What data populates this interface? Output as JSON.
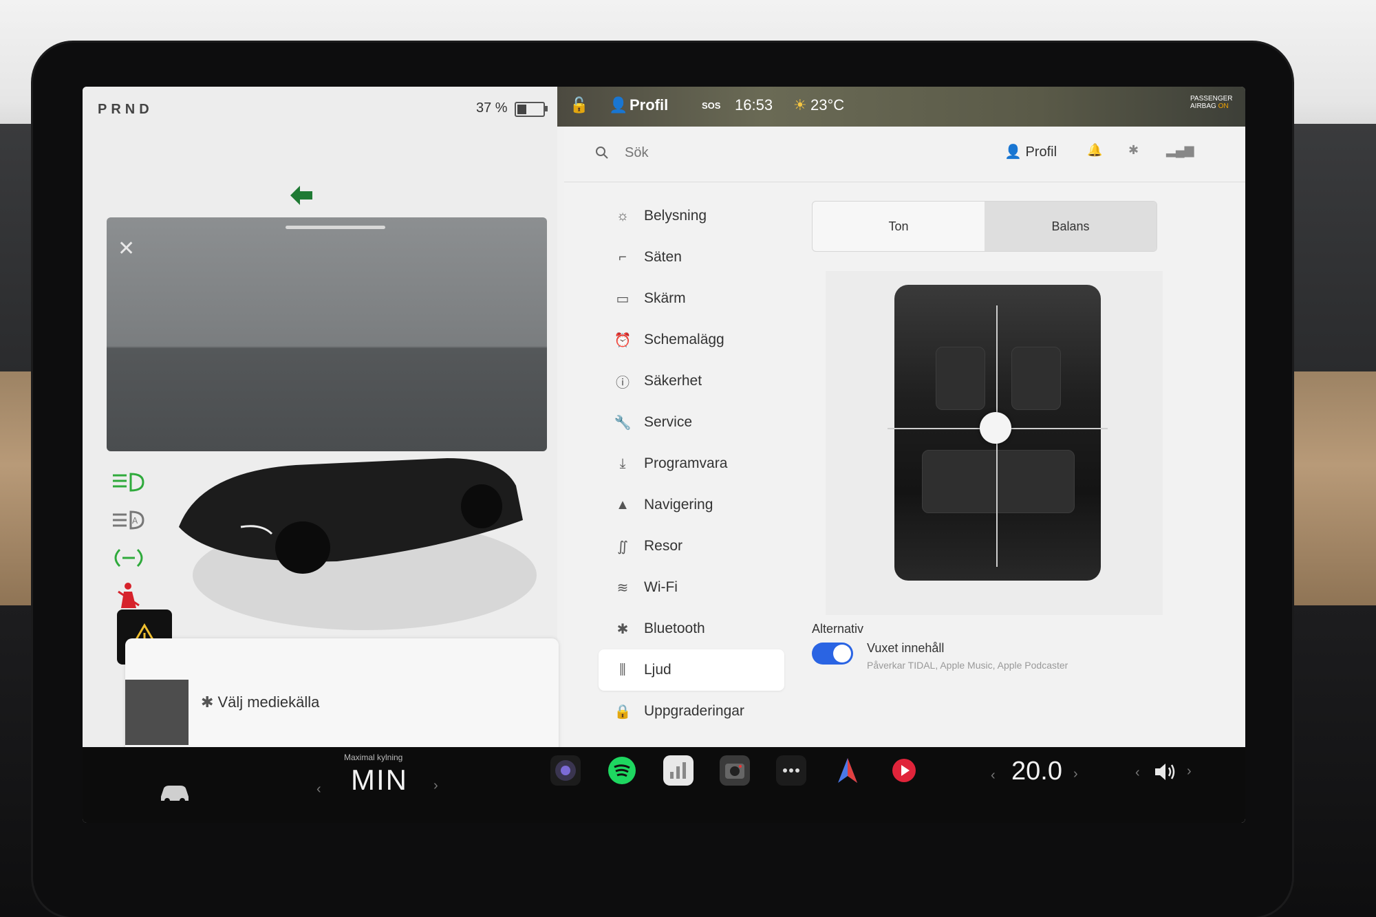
{
  "left_panel": {
    "gear": "PRND",
    "battery_percent": "37 %",
    "battery_level": 0.37,
    "media": {
      "source_label": "Välj mediekälla"
    }
  },
  "status_bar": {
    "profile": "Profil",
    "sos": "SOS",
    "time": "16:53",
    "temperature": "23°C",
    "airbag_line1": "PASSENGER",
    "airbag_line2": "AIRBAG",
    "airbag_state": "ON"
  },
  "settings": {
    "search_placeholder": "Sök",
    "profile": "Profil",
    "menu": [
      {
        "label": "Belysning",
        "icon": "sun-icon"
      },
      {
        "label": "Säten",
        "icon": "seat-icon"
      },
      {
        "label": "Skärm",
        "icon": "display-icon"
      },
      {
        "label": "Schemalägg",
        "icon": "alarm-clock-icon"
      },
      {
        "label": "Säkerhet",
        "icon": "safety-icon"
      },
      {
        "label": "Service",
        "icon": "wrench-icon"
      },
      {
        "label": "Programvara",
        "icon": "download-icon"
      },
      {
        "label": "Navigering",
        "icon": "navigation-arrow-icon"
      },
      {
        "label": "Resor",
        "icon": "trips-icon"
      },
      {
        "label": "Wi-Fi",
        "icon": "wifi-icon"
      },
      {
        "label": "Bluetooth",
        "icon": "bluetooth-icon"
      },
      {
        "label": "Ljud",
        "icon": "equalizer-icon",
        "active": true
      },
      {
        "label": "Uppgraderingar",
        "icon": "lock-icon"
      }
    ],
    "audio": {
      "tabs": [
        "Ton",
        "Balans"
      ],
      "selected_tab": "Balans",
      "alternativ_label": "Alternativ",
      "explicit_label": "Vuxet innehåll",
      "explicit_sub": "Påverkar TIDAL, Apple Music, Apple Podcaster",
      "explicit_on": true
    }
  },
  "bottom_bar": {
    "climate_caption": "Maximal kylning",
    "climate_value": "MIN",
    "temperature_value": "20.0"
  },
  "colors": {
    "accent": "#2a64e3",
    "turn_signal": "#1f7a34",
    "indicator_green": "#2faa3c",
    "seatbelt_red": "#d6222b"
  }
}
